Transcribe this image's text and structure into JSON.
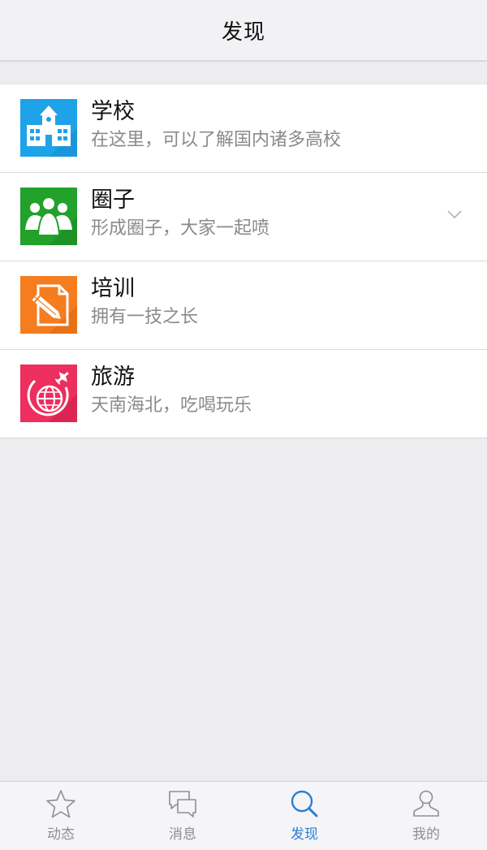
{
  "header": {
    "title": "发现"
  },
  "list": [
    {
      "title": "学校",
      "subtitle": "在这里，可以了解国内诸多高校",
      "icon": "school-building-icon",
      "color": "#1ea2e8"
    },
    {
      "title": "圈子",
      "subtitle": "形成圈子，大家一起喷",
      "icon": "group-people-icon",
      "color": "#22a12b"
    },
    {
      "title": "培训",
      "subtitle": "拥有一技之长",
      "icon": "pencil-paper-icon",
      "color": "#f57c1f"
    },
    {
      "title": "旅游",
      "subtitle": "天南海北，吃喝玩乐",
      "icon": "globe-plane-icon",
      "color": "#ec2f5e"
    }
  ],
  "tabbar": {
    "tabs": [
      {
        "label": "动态",
        "icon": "star-icon"
      },
      {
        "label": "消息",
        "icon": "chat-bubbles-icon"
      },
      {
        "label": "发现",
        "icon": "search-icon",
        "active": true
      },
      {
        "label": "我的",
        "icon": "person-icon"
      }
    ],
    "active_color": "#2a7fd6",
    "inactive_color": "#8e8e93"
  }
}
